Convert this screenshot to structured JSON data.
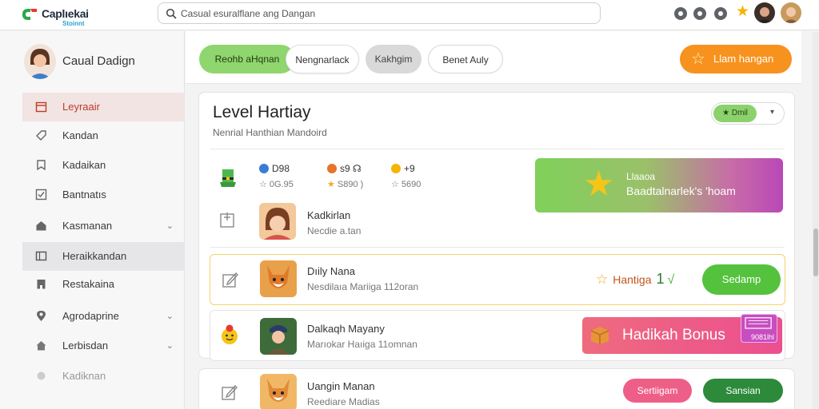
{
  "app": {
    "logo_text": "Caplıekai",
    "logo_sub": "Stoinnt",
    "brand_color": "#f7921e",
    "accent_green": "#8fd66e"
  },
  "search": {
    "placeholder": "Casual esuralflane ang Dangan",
    "value": ""
  },
  "top_icons": [
    "help-icon",
    "notification-icon",
    "settings-icon",
    "star-icon"
  ],
  "profile": {
    "name": "Caual Dadign"
  },
  "sidebar": {
    "items": [
      {
        "label": "Leyraair",
        "icon": "calendar-icon"
      },
      {
        "label": "Kandan",
        "icon": "tag-icon"
      },
      {
        "label": "Kadaikan",
        "icon": "bookmark-icon"
      },
      {
        "label": "Bantnatıs",
        "icon": "check-icon"
      },
      {
        "label": "Kasmanan",
        "icon": "home-icon"
      },
      {
        "label": "Heraikkandan",
        "icon": "grid-icon"
      },
      {
        "label": "Restakaina",
        "icon": "building-icon"
      },
      {
        "label": "Agrodaprine",
        "icon": "location-pin-icon"
      },
      {
        "label": "Lerbisdan",
        "icon": "house-icon"
      },
      {
        "label": "Kadiknan",
        "icon": "more-icon"
      }
    ]
  },
  "tabs": [
    {
      "label": "Reohb aHqnan"
    },
    {
      "label": "Nengnarlack"
    },
    {
      "label": "Kakhgim"
    },
    {
      "label": "Benet Auly"
    }
  ],
  "cta": {
    "label": "Llam hangan"
  },
  "card": {
    "title": "Level Hartiay",
    "subtitle": "Nenrial Hanthian Mandoird",
    "filter_label": "★ Dmil",
    "stats": [
      {
        "value": "D98",
        "sub": "0G.95",
        "color": "#3a7bd5"
      },
      {
        "value": "s9",
        "sub": "S890 )",
        "color": "#e8732b"
      },
      {
        "value": "+9",
        "sub": "5690",
        "color": "#f5b400"
      }
    ],
    "banner": {
      "line1": "Llaaoa",
      "line2": "Baadtalnarlek's 'hoam"
    },
    "first_row": {
      "name": "Kadkirlan",
      "sub": "Necdie a.tan"
    }
  },
  "rows": [
    {
      "name": "Dıily Nana",
      "sub": "Nesdilaıa Mariiga 112oran",
      "rank_label": "Hantiga",
      "rank_number": "1",
      "action": "Sedamp"
    },
    {
      "name": "Dalkaqh Mayany",
      "sub": "Marıokar Haıiga 11omnan",
      "bonus_label": "Hadikah Bonus",
      "bonus_tag": "9081lhl"
    },
    {
      "name": "Uangin Manan",
      "sub": "Reediare Madias",
      "action_pink": "Sertiigam",
      "action_green": "Sansian"
    }
  ]
}
